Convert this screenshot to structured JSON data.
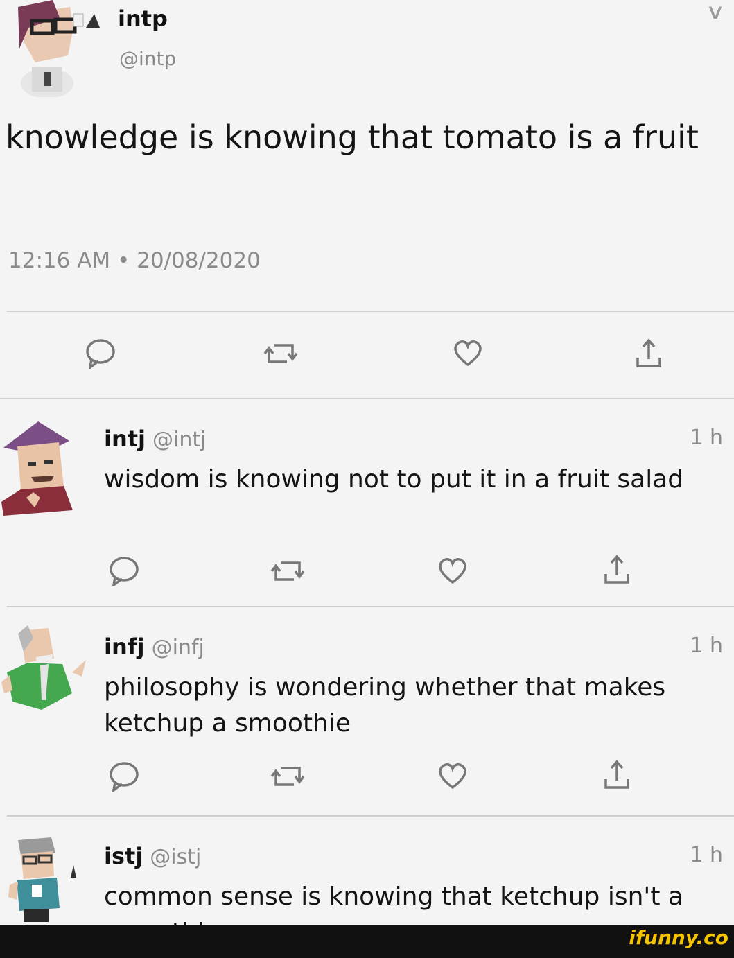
{
  "main_tweet": {
    "name": "intp",
    "handle": "@intp",
    "text": "knowledge is knowing that tomato is a fruit",
    "timestamp": "12:16 AM • 20/08/2020"
  },
  "replies": [
    {
      "name": "intj",
      "handle": "@intj",
      "time": "1 h",
      "text": "wisdom is knowing not to put it in a fruit salad"
    },
    {
      "name": "infj",
      "handle": "@infj",
      "time": "1 h",
      "text": "philosophy is wondering whether that makes ketchup a smoothie"
    },
    {
      "name": "istj",
      "handle": "@istj",
      "time": "1 h",
      "text": "common sense is knowing that ketchup isn't a smoothie"
    }
  ],
  "icons": [
    "reply-icon",
    "retweet-icon",
    "like-icon",
    "share-icon",
    "chevron-down-icon"
  ],
  "watermark": "ifunny.co",
  "colors": {
    "text": "#141414",
    "muted": "#8a8a8a",
    "icon": "#9a9a9a",
    "watermark": "#f5c400"
  }
}
